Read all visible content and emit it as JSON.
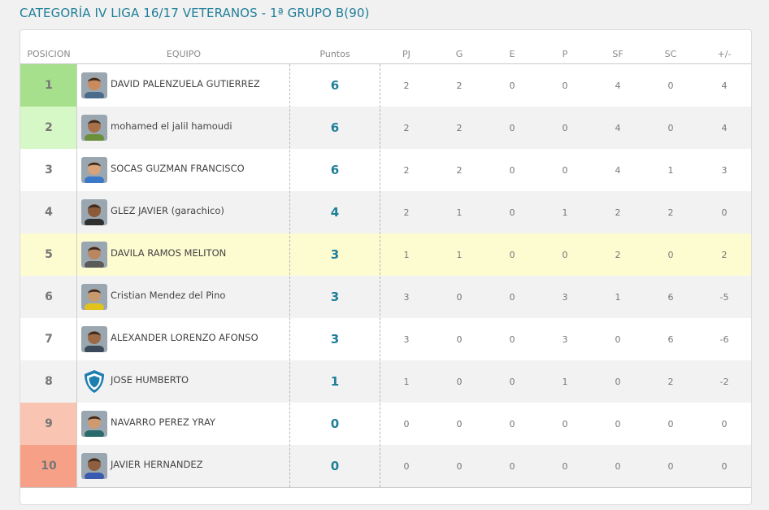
{
  "title": "CATEGORÍA IV LIGA 16/17 VETERANOS - 1ª GRUPO B(90)",
  "colors": {
    "title": "#1f7e99",
    "promo_1": "#a6e08c",
    "promo_2": "#d6f7c6",
    "relegation_1": "#f9c4b2",
    "relegation_2": "#f7a088",
    "highlight": "#fdfbd0"
  },
  "headers": {
    "pos": "POSICION",
    "team": "EQUIPO",
    "pts": "Puntos",
    "pj": "PJ",
    "g": "G",
    "e": "E",
    "p": "P",
    "sf": "SF",
    "sc": "SC",
    "diff": "+/-"
  },
  "rows": [
    {
      "pos": "1",
      "team": "DAVID PALENZUELA GUTIERREZ",
      "avatar": "player-photo",
      "pts": "6",
      "pj": "2",
      "g": "2",
      "e": "0",
      "p": "0",
      "sf": "4",
      "sc": "0",
      "diff": "4"
    },
    {
      "pos": "2",
      "team": "mohamed el jalil hamoudi",
      "avatar": "player-photo",
      "pts": "6",
      "pj": "2",
      "g": "2",
      "e": "0",
      "p": "0",
      "sf": "4",
      "sc": "0",
      "diff": "4"
    },
    {
      "pos": "3",
      "team": "SOCAS GUZMAN FRANCISCO",
      "avatar": "player-photo",
      "pts": "6",
      "pj": "2",
      "g": "2",
      "e": "0",
      "p": "0",
      "sf": "4",
      "sc": "1",
      "diff": "3"
    },
    {
      "pos": "4",
      "team": "GLEZ JAVIER (garachico)",
      "avatar": "player-photo",
      "pts": "4",
      "pj": "2",
      "g": "1",
      "e": "0",
      "p": "1",
      "sf": "2",
      "sc": "2",
      "diff": "0"
    },
    {
      "pos": "5",
      "team": "DAVILA RAMOS MELITON",
      "avatar": "player-photo",
      "pts": "3",
      "pj": "1",
      "g": "1",
      "e": "0",
      "p": "0",
      "sf": "2",
      "sc": "0",
      "diff": "2"
    },
    {
      "pos": "6",
      "team": "Cristian Mendez del Pino",
      "avatar": "player-photo",
      "pts": "3",
      "pj": "3",
      "g": "0",
      "e": "0",
      "p": "3",
      "sf": "1",
      "sc": "6",
      "diff": "-5"
    },
    {
      "pos": "7",
      "team": "ALEXANDER LORENZO AFONSO",
      "avatar": "player-photo",
      "pts": "3",
      "pj": "3",
      "g": "0",
      "e": "0",
      "p": "3",
      "sf": "0",
      "sc": "6",
      "diff": "-6"
    },
    {
      "pos": "8",
      "team": "JOSE HUMBERTO",
      "avatar": "shield-icon",
      "pts": "1",
      "pj": "1",
      "g": "0",
      "e": "0",
      "p": "1",
      "sf": "0",
      "sc": "2",
      "diff": "-2"
    },
    {
      "pos": "9",
      "team": "NAVARRO PEREZ YRAY",
      "avatar": "player-photo",
      "pts": "0",
      "pj": "0",
      "g": "0",
      "e": "0",
      "p": "0",
      "sf": "0",
      "sc": "0",
      "diff": "0"
    },
    {
      "pos": "10",
      "team": "JAVIER HERNANDEZ",
      "avatar": "player-photo",
      "pts": "0",
      "pj": "0",
      "g": "0",
      "e": "0",
      "p": "0",
      "sf": "0",
      "sc": "0",
      "diff": "0"
    }
  ]
}
